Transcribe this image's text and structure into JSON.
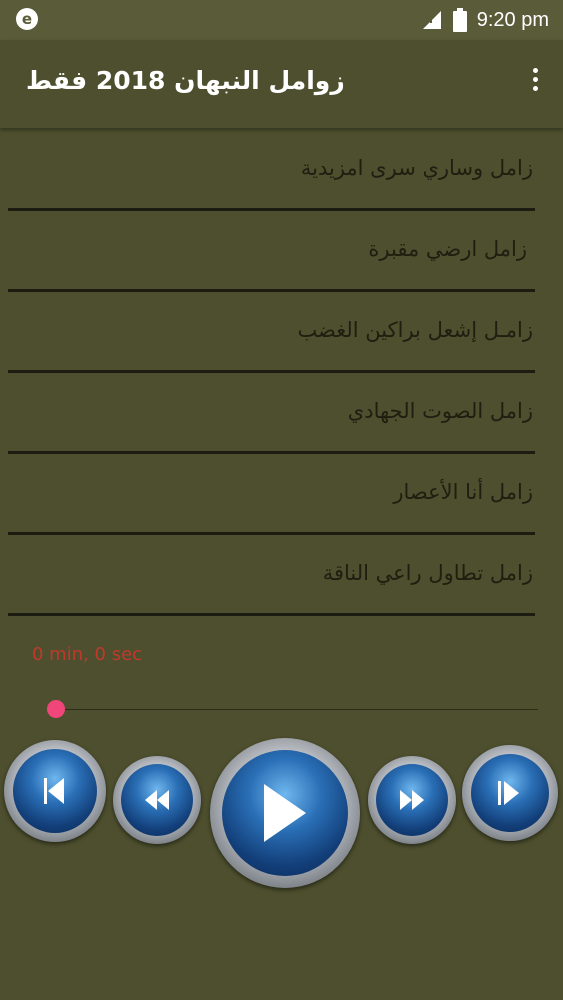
{
  "status_bar": {
    "app_icon_letter": "e",
    "time": "9:20 pm"
  },
  "app_bar": {
    "title": "زوامل النبهان 2018 فقط",
    "menu_icon": "more-vert-icon"
  },
  "tracks": [
    {
      "label": "زامل وساري سرى امزيدية"
    },
    {
      "label": "زامل ارضي مقبرة"
    },
    {
      "label": "زامـل إشعل براكين الغضب"
    },
    {
      "label": "زامل الصوت الجهادي"
    },
    {
      "label": "زامل أنا الأعصار"
    },
    {
      "label": "زامل تطاول راعي الناقة"
    }
  ],
  "player": {
    "elapsed": "0 min, 0 sec",
    "progress": 0,
    "controls": [
      "previous-track-icon",
      "rewind-icon",
      "play-icon",
      "fast-forward-icon",
      "next-track-icon"
    ]
  },
  "colors": {
    "background": "#4d4f2e",
    "status_bar": "#5a5c39",
    "divider": "#1c1d10",
    "elapsed_text": "#c0392b",
    "seek_thumb": "#f0467a",
    "button_blue": "#2a6fb6"
  }
}
